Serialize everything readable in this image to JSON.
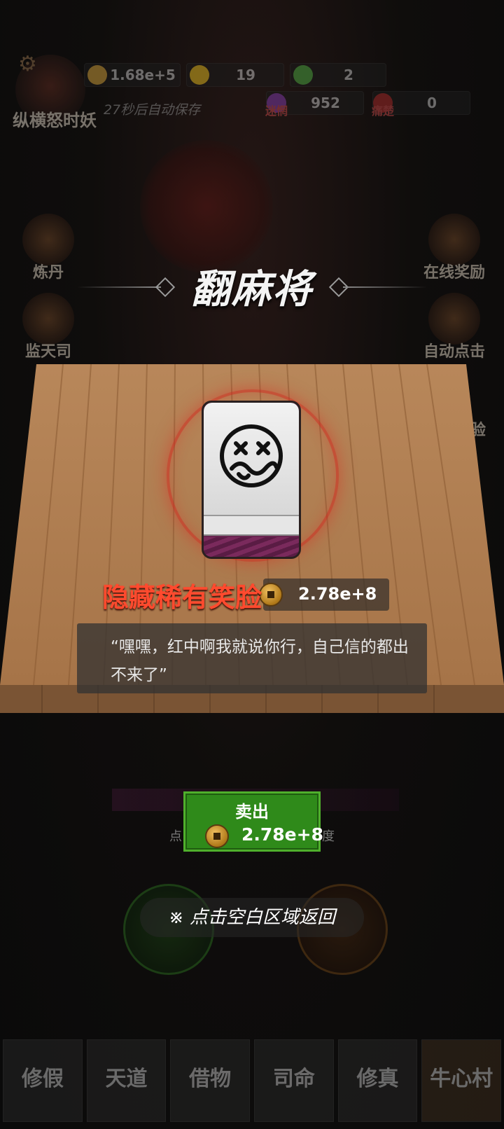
{
  "player": {
    "name": "纵横怒时妖",
    "autosave": "27秒后自动保存"
  },
  "resources": [
    {
      "value": "1.68e+5",
      "icon": "coin-icon",
      "color": "#c89a3a"
    },
    {
      "value": "19",
      "icon": "lightning-icon",
      "color": "#d8b020"
    },
    {
      "value": "2",
      "icon": "jade-icon",
      "color": "#4aa040"
    }
  ],
  "resources2": [
    {
      "label": "迷惘",
      "value": "952",
      "icon": "purple-orb-icon",
      "color": "#7a3aa0"
    },
    {
      "label": "痛楚",
      "value": "0",
      "icon": "red-orb-icon",
      "color": "#a02a2a"
    }
  ],
  "side_buttons": {
    "left": [
      "炼丹",
      "监天司"
    ],
    "right": [
      "在线奖励",
      "自动点击"
    ],
    "right_partial": "验"
  },
  "dialog": {
    "title": "翻麻将",
    "tile_name": "隐藏稀有笑脸",
    "tile_value": "2.78e+8",
    "quote": "“嘿嘿，红中啊我就说你行，自己信的都出不来了”",
    "sell_label": "卖出",
    "sell_value": "2.78e+8",
    "hint": "※ 点击空白区域返回"
  },
  "background_text": {
    "left_fragment": "点",
    "right_fragment": "度"
  },
  "nav": [
    "修假",
    "天道",
    "借物",
    "司命",
    "修真",
    "牛心村"
  ],
  "colors": {
    "rare_name": "#ff4a2e",
    "sell_button": "#2f8a1a",
    "glow": "#d8281e"
  }
}
